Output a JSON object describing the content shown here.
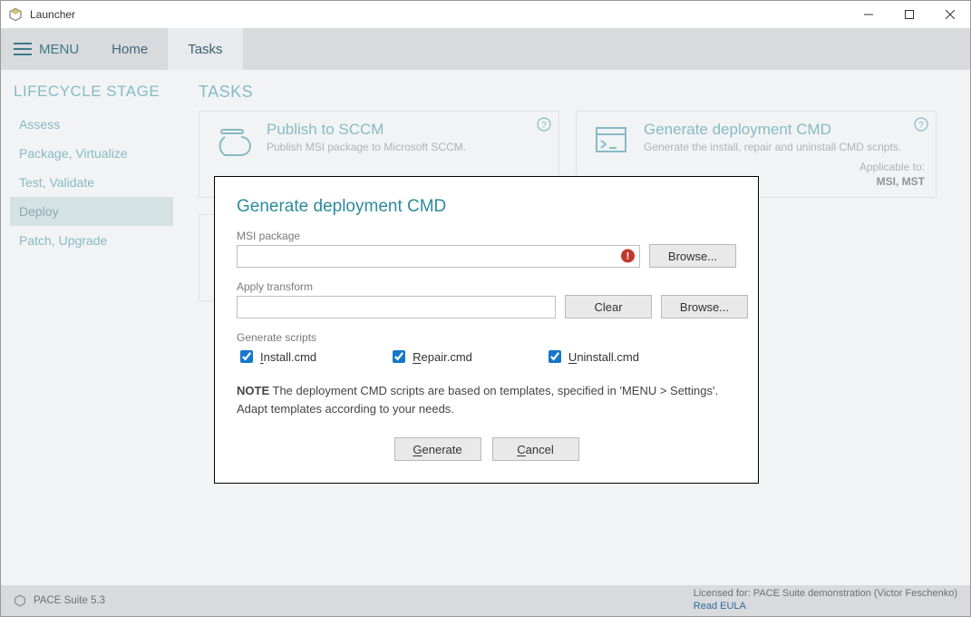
{
  "window": {
    "title": "Launcher"
  },
  "menubar": {
    "menu_label": "MENU",
    "tabs": {
      "home": "Home",
      "tasks": "Tasks"
    },
    "active": "tasks"
  },
  "sidebar": {
    "heading": "LIFECYCLE STAGE",
    "items": [
      {
        "label": "Assess"
      },
      {
        "label": "Package, Virtualize"
      },
      {
        "label": "Test, Validate"
      },
      {
        "label": "Deploy"
      },
      {
        "label": "Patch, Upgrade"
      }
    ],
    "selected_index": 3
  },
  "content": {
    "heading": "TASKS",
    "cards": [
      {
        "title": "Publish to SCCM",
        "desc": "Publish MSI package to Microsoft SCCM."
      },
      {
        "title": "Generate deployment CMD",
        "desc": "Generate the install, repair and uninstall CMD scripts.",
        "applicable_label": "Applicable to:",
        "applicable_value": "MSI, MST"
      }
    ]
  },
  "modal": {
    "title": "Generate deployment CMD",
    "msi_label": "MSI package",
    "msi_value": "",
    "browse_label": "Browse...",
    "transform_label": "Apply transform",
    "transform_value": "",
    "clear_label": "Clear",
    "scripts_label": "Generate scripts",
    "checks": {
      "install": {
        "u": "I",
        "rest": "nstall.cmd",
        "checked": true
      },
      "repair": {
        "u": "R",
        "rest": "epair.cmd",
        "checked": true
      },
      "uninstall": {
        "u": "U",
        "rest": "ninstall.cmd",
        "checked": true
      }
    },
    "note_bold": "NOTE",
    "note_text": " The deployment CMD scripts are based on templates, specified in 'MENU > Settings'. Adapt templates according to your needs.",
    "generate": {
      "u": "G",
      "rest": "enerate"
    },
    "cancel": {
      "u": "C",
      "rest": "ancel"
    }
  },
  "footer": {
    "product": "PACE Suite 5.3",
    "licensed": "Licensed for: PACE Suite demonstration (Victor Feschenko)",
    "eula": "Read EULA"
  }
}
